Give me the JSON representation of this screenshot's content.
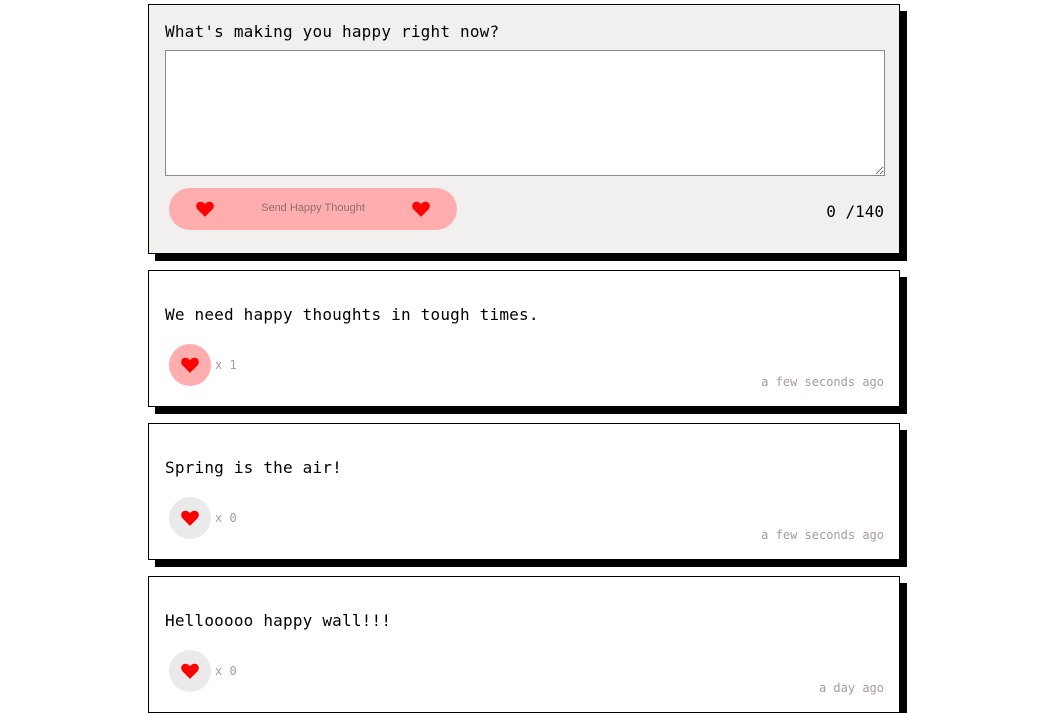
{
  "form": {
    "title": "What's making you happy right now?",
    "input_value": "",
    "send_label": "Send Happy Thought",
    "char_count": "0 /140"
  },
  "icons": {
    "heart": "heart-icon",
    "heart_color": "#ff0000"
  },
  "colors": {
    "button_pink": "#ffadad",
    "like_unliked": "#eaeaea",
    "form_background": "#f2f0ee"
  },
  "thoughts": [
    {
      "message": "We need happy thoughts in tough times.",
      "likes_label": "x 1",
      "time": "a few seconds ago",
      "liked": true
    },
    {
      "message": "Spring is the air!",
      "likes_label": "x 0",
      "time": "a few seconds ago",
      "liked": false
    },
    {
      "message": "Hellooooo happy wall!!!",
      "likes_label": "x 0",
      "time": "a day ago",
      "liked": false
    }
  ]
}
